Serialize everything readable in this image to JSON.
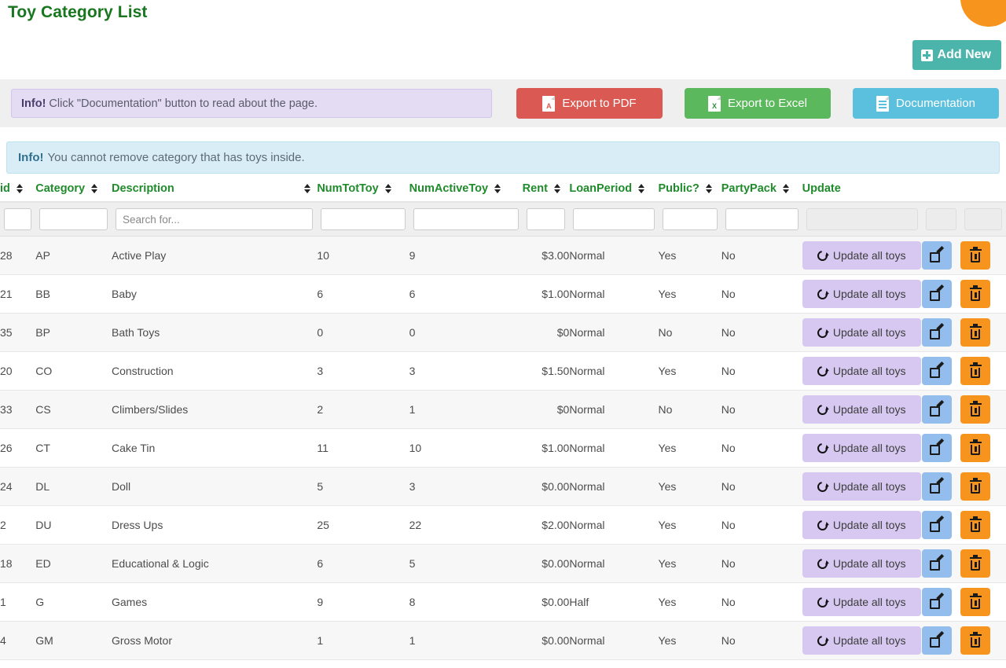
{
  "page": {
    "title": "Toy Category List"
  },
  "header": {
    "add_new_label": "Add New",
    "add_new_icon": "plus-square-icon"
  },
  "toolbar": {
    "info_alert": {
      "strong": "Info!",
      "text": " Click \"Documentation\" button to read about the page."
    },
    "buttons": [
      {
        "label": "Export to PDF",
        "icon": "pdf-file-icon",
        "glyph": "A",
        "color": "#da5a53"
      },
      {
        "label": "Export to Excel",
        "icon": "excel-file-icon",
        "glyph": "X",
        "color": "#5cb85c"
      },
      {
        "label": "Documentation",
        "icon": "document-icon",
        "glyph": "",
        "color": "#5bc0de"
      }
    ]
  },
  "notice": {
    "strong": "Info!",
    "text": " You cannot remove category that has toys inside."
  },
  "table": {
    "columns": [
      {
        "label": "id",
        "sortable": true,
        "align": "left"
      },
      {
        "label": "Category",
        "sortable": true,
        "align": "left"
      },
      {
        "label": "Description",
        "sortable": true,
        "align": "left"
      },
      {
        "label": "NumTotToy",
        "sortable": true,
        "align": "left"
      },
      {
        "label": "NumActiveToy",
        "sortable": true,
        "align": "left"
      },
      {
        "label": "Rent",
        "sortable": true,
        "align": "right"
      },
      {
        "label": "LoanPeriod",
        "sortable": true,
        "align": "left"
      },
      {
        "label": "Public?",
        "sortable": true,
        "align": "left"
      },
      {
        "label": "PartyPack",
        "sortable": true,
        "align": "left"
      },
      {
        "label": "Update",
        "sortable": false,
        "align": "left"
      }
    ],
    "filters": {
      "id": {
        "value": "",
        "placeholder": "",
        "disabled": false
      },
      "category": {
        "value": "",
        "placeholder": "",
        "disabled": false
      },
      "description": {
        "value": "",
        "placeholder": "Search for...",
        "disabled": false
      },
      "numtottoy": {
        "value": "",
        "placeholder": "",
        "disabled": false
      },
      "numactivetoy": {
        "value": "",
        "placeholder": "",
        "disabled": false
      },
      "rent": {
        "value": "",
        "placeholder": "",
        "disabled": false
      },
      "loanperiod": {
        "value": "",
        "placeholder": "",
        "disabled": false
      },
      "public": {
        "value": "",
        "placeholder": "",
        "disabled": false
      },
      "partypack": {
        "value": "",
        "placeholder": "",
        "disabled": false
      },
      "update": {
        "value": "",
        "placeholder": "",
        "disabled": true
      },
      "edit": {
        "value": "",
        "placeholder": "",
        "disabled": true
      },
      "delete": {
        "value": "",
        "placeholder": "",
        "disabled": true
      }
    },
    "row_action": {
      "update_label": "Update all toys",
      "update_icon": "refresh-icon",
      "edit_icon": "pen-to-square-icon",
      "delete_icon": "trash-icon"
    },
    "rows": [
      {
        "id": "28",
        "category": "AP",
        "description": "Active Play",
        "numtottoy": "10",
        "numactivetoy": "9",
        "rent": "$3.00",
        "loanperiod": "Normal",
        "public": "Yes",
        "partypack": "No"
      },
      {
        "id": "21",
        "category": "BB",
        "description": "Baby",
        "numtottoy": "6",
        "numactivetoy": "6",
        "rent": "$1.00",
        "loanperiod": "Normal",
        "public": "Yes",
        "partypack": "No"
      },
      {
        "id": "35",
        "category": "BP",
        "description": "Bath Toys",
        "numtottoy": "0",
        "numactivetoy": "0",
        "rent": "$0",
        "loanperiod": "Normal",
        "public": "No",
        "partypack": "No"
      },
      {
        "id": "20",
        "category": "CO",
        "description": "Construction",
        "numtottoy": "3",
        "numactivetoy": "3",
        "rent": "$1.50",
        "loanperiod": "Normal",
        "public": "Yes",
        "partypack": "No"
      },
      {
        "id": "33",
        "category": "CS",
        "description": "Climbers/Slides",
        "numtottoy": "2",
        "numactivetoy": "1",
        "rent": "$0",
        "loanperiod": "Normal",
        "public": "No",
        "partypack": "No"
      },
      {
        "id": "26",
        "category": "CT",
        "description": "Cake Tin",
        "numtottoy": "11",
        "numactivetoy": "10",
        "rent": "$1.00",
        "loanperiod": "Normal",
        "public": "Yes",
        "partypack": "No"
      },
      {
        "id": "24",
        "category": "DL",
        "description": "Doll",
        "numtottoy": "5",
        "numactivetoy": "3",
        "rent": "$0.00",
        "loanperiod": "Normal",
        "public": "Yes",
        "partypack": "No"
      },
      {
        "id": "2",
        "category": "DU",
        "description": "Dress Ups",
        "numtottoy": "25",
        "numactivetoy": "22",
        "rent": "$2.00",
        "loanperiod": "Normal",
        "public": "Yes",
        "partypack": "No"
      },
      {
        "id": "18",
        "category": "ED",
        "description": "Educational & Logic",
        "numtottoy": "6",
        "numactivetoy": "5",
        "rent": "$0.00",
        "loanperiod": "Normal",
        "public": "Yes",
        "partypack": "No"
      },
      {
        "id": "1",
        "category": "G",
        "description": "Games",
        "numtottoy": "9",
        "numactivetoy": "8",
        "rent": "$0.00",
        "loanperiod": "Half",
        "public": "Yes",
        "partypack": "No"
      },
      {
        "id": "4",
        "category": "GM",
        "description": "Gross Motor",
        "numtottoy": "1",
        "numactivetoy": "1",
        "rent": "$0.00",
        "loanperiod": "Normal",
        "public": "Yes",
        "partypack": "No"
      }
    ]
  },
  "colors": {
    "title_green": "#17761e",
    "header_green": "#1f8b2b",
    "add_new_teal": "#4cb5ab",
    "pdf_red": "#da5a53",
    "excel_green": "#5cb85c",
    "doc_blue": "#5bc0de",
    "update_purple": "#d6c8f0",
    "edit_blue": "#93bdec",
    "delete_orange": "#f7941e",
    "alert_purple_bg": "#e4dcf3",
    "alert_blue_bg": "#d9edf7"
  }
}
